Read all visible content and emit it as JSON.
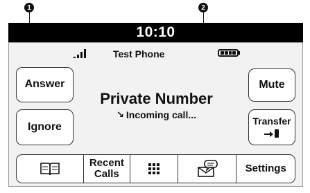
{
  "callouts": [
    "1",
    "2"
  ],
  "header": {
    "clock": "10:10"
  },
  "status_bar": {
    "signal_icon": "signal-bars-icon",
    "phone_name": "Test Phone",
    "battery_icon": "battery-icon"
  },
  "call": {
    "caller": "Private Number",
    "status": "Incoming call...",
    "status_icon": "incoming-call-arrow-icon"
  },
  "left_buttons": {
    "answer": "Answer",
    "ignore": "Ignore"
  },
  "right_buttons": {
    "mute": "Mute",
    "transfer": "Transfer"
  },
  "bottom_bar": {
    "phonebook_icon": "phonebook-icon",
    "recent_calls_line1": "Recent",
    "recent_calls_line2": "Calls",
    "keypad_icon": "keypad-icon",
    "messages_icon": "messages-icon",
    "settings": "Settings"
  }
}
